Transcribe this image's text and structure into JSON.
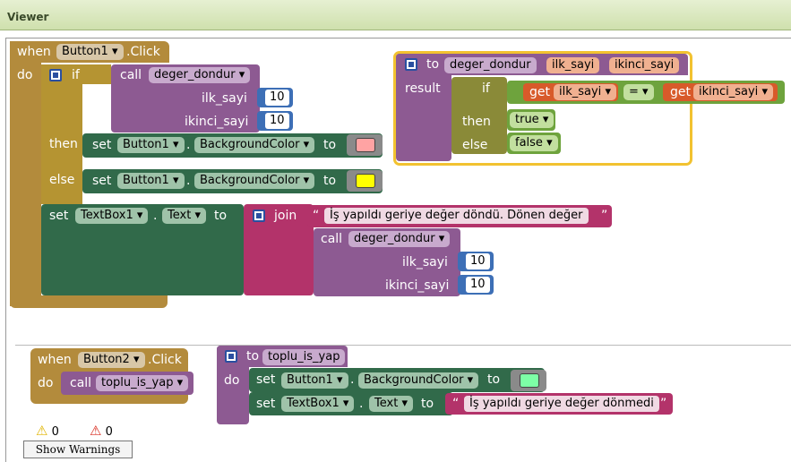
{
  "viewer": {
    "title": "Viewer"
  },
  "event1": {
    "when": "when",
    "component": "Button1",
    "event": ".Click",
    "do": "do",
    "if": "if",
    "then": "then",
    "else": "else",
    "call": "call",
    "proc": "deger_dondur",
    "arg1_label": "ilk_sayi",
    "arg1_value": "10",
    "arg2_label": "ikinci_sayi",
    "arg2_value": "10",
    "set": "set",
    "dot": ".",
    "then_component": "Button1",
    "then_property": "BackgroundColor",
    "then_to": "to",
    "then_color": "#ffa3a3",
    "else_component": "Button1",
    "else_property": "BackgroundColor",
    "else_to": "to",
    "else_color": "#ffff00",
    "set_component": "TextBox1",
    "set_property": "Text",
    "set_to": "to",
    "join": "join",
    "string_text": "İş yapıldı geriye değer döndü. Dönen değer",
    "call2": "call",
    "proc2": "deger_dondur",
    "arg3_label": "ilk_sayi",
    "arg3_value": "10",
    "arg4_label": "ikinci_sayi",
    "arg4_value": "10"
  },
  "procResult": {
    "to": "to",
    "name": "deger_dondur",
    "param1": "ilk_sayi",
    "param2": "ikinci_sayi",
    "result": "result",
    "if": "if",
    "get1": "get",
    "get1_var": "ilk_sayi",
    "op": "=",
    "get2": "get",
    "get2_var": "ikinci_sayi",
    "then": "then",
    "then_value": "true",
    "else": "else",
    "else_value": "false"
  },
  "event2": {
    "when": "when",
    "component": "Button2",
    "event": ".Click",
    "do": "do",
    "call": "call",
    "proc": "toplu_is_yap"
  },
  "procDo": {
    "to": "to",
    "name": "toplu_is_yap",
    "do": "do",
    "set1": "set",
    "set1_component": "Button1",
    "set1_property": "BackgroundColor",
    "set1_to": "to",
    "set1_color": "#7dffa6",
    "set2": "set",
    "set2_component": "TextBox1",
    "set2_property": "Text",
    "set2_to": "to",
    "string_text": "İş yapıldı geriye değer dönmedi"
  },
  "warnings": {
    "warning_count": "0",
    "error_count": "0",
    "button_label": "Show Warnings"
  },
  "colors": {
    "event": "#b38b3c",
    "procedure": "#8d5a92",
    "component_set": "#316a4a",
    "text": "#b3336a",
    "math": "#3d6fb6",
    "logic": "#6ea33d",
    "variable": "#d85a2a"
  },
  "icons": {
    "mutator": "gear-mutator-icon",
    "dropdown": "chevron-down-icon",
    "warning": "warning-triangle-icon",
    "error": "error-triangle-icon"
  }
}
